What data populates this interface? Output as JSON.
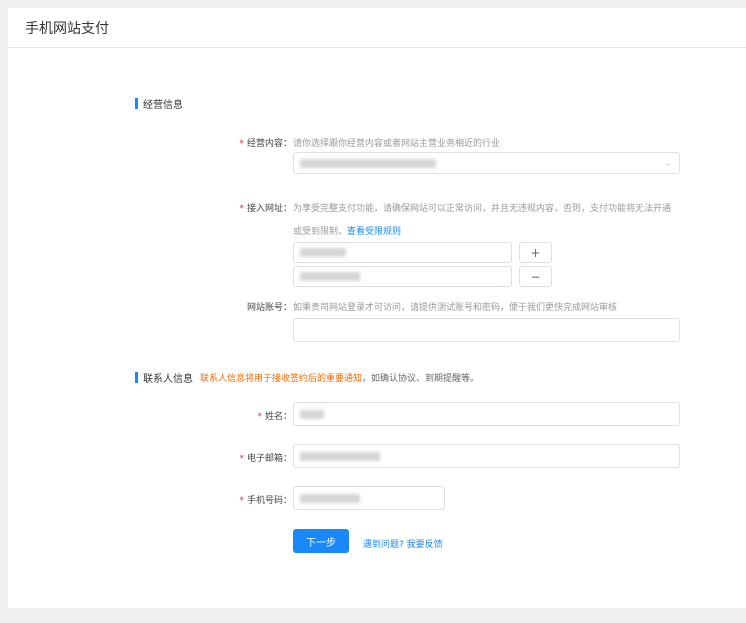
{
  "page": {
    "title": "手机网站支付"
  },
  "business": {
    "section_title": "经营信息",
    "content": {
      "label": "经营内容：",
      "hint": "请你选择跟你经营内容或者网站主营业务相近的行业"
    },
    "url": {
      "label": "接入网址：",
      "hint_line1": "为享受完整支付功能，请确保网站可以正常访问，并且无违规内容，否则，支付功能将无法开通",
      "hint_line2": "或受到限制，",
      "rule_link": "查看受限规则",
      "add_symbol": "+",
      "remove_symbol": "−"
    },
    "account": {
      "label": "网站账号：",
      "hint": "如果贵司网站登录才可访问，请提供测试账号和密码，便于我们更快完成网站审核"
    }
  },
  "contact": {
    "section_title": "联系人信息",
    "warning": "联系人信息将用于接收签约后的重要通知",
    "note": "，如确认协议、到期提醒等。",
    "name_label": "姓名：",
    "email_label": "电子邮箱：",
    "phone_label": "手机号码："
  },
  "actions": {
    "next_label": "下一步",
    "feedback_link": "遇到问题? 我要反馈"
  },
  "colors": {
    "accent": "#1989fa",
    "warning": "#ff6a00",
    "required": "#f5222d"
  }
}
